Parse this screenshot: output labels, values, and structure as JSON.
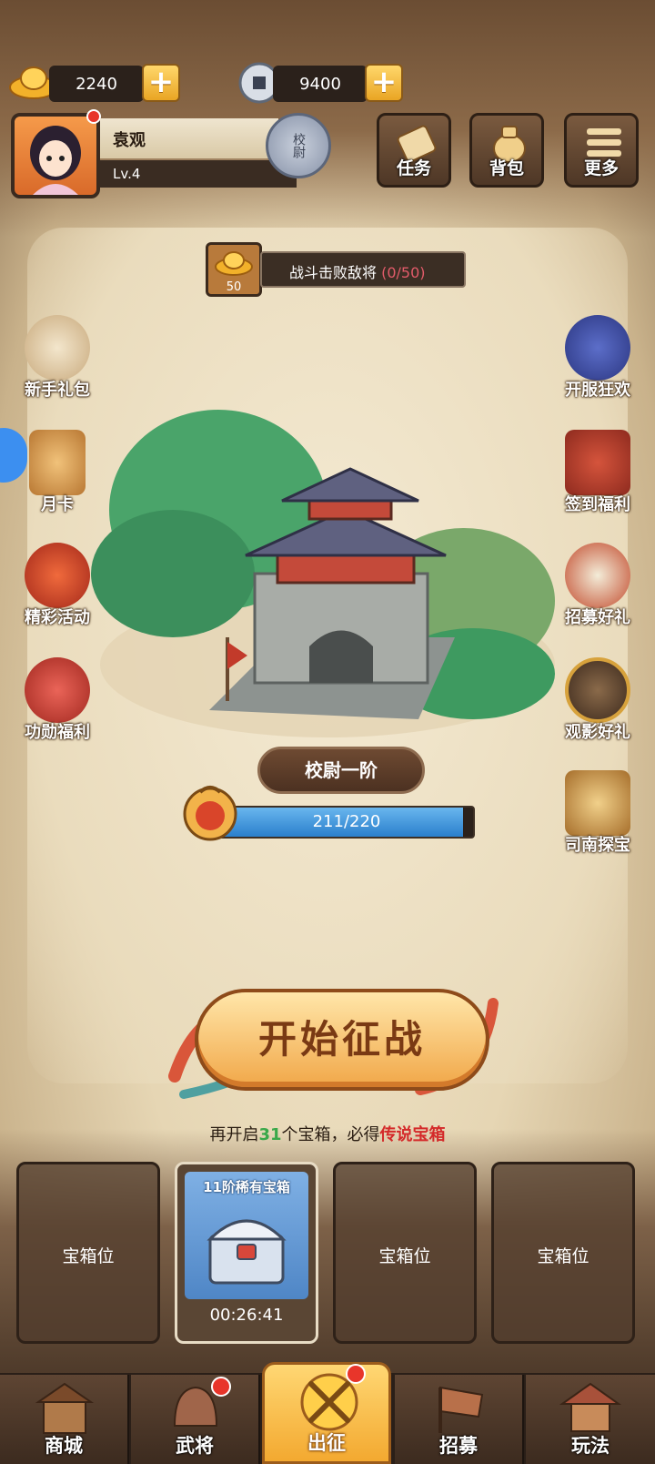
{
  "currency": {
    "gold": "2240",
    "coin": "9400",
    "gold_icon": "gold-ingot-icon",
    "coin_icon": "copper-coin-icon"
  },
  "player": {
    "name": "袁观",
    "level": "Lv.4",
    "rank_badge": "校尉"
  },
  "top_buttons": [
    {
      "label": "任务",
      "icon": "scroll-icon"
    },
    {
      "label": "背包",
      "icon": "bag-icon"
    },
    {
      "label": "更多",
      "icon": "menu-icon"
    }
  ],
  "quest": {
    "reward": "50",
    "text": "战斗击败敌将",
    "progress": "(0/50)"
  },
  "left_side": [
    {
      "label": "新手礼包",
      "icon": "hero-gift-icon"
    },
    {
      "label": "月卡",
      "icon": "month-card-icon"
    },
    {
      "label": "精彩活动",
      "icon": "event-bag-icon"
    },
    {
      "label": "功勋福利",
      "icon": "merit-pouch-icon"
    }
  ],
  "right_side": [
    {
      "label": "开服狂欢",
      "icon": "carnival-icon"
    },
    {
      "label": "签到福利",
      "icon": "signin-icon"
    },
    {
      "label": "招募好礼",
      "icon": "recruit-drum-icon"
    },
    {
      "label": "观影好礼",
      "icon": "video-gift-icon"
    },
    {
      "label": "司南探宝",
      "icon": "compass-icon"
    }
  ],
  "rank": {
    "title": "校尉一阶",
    "progress_text": "211/220",
    "progress_value": 0.959
  },
  "start_button": "开始征战",
  "chest_hint": {
    "pre": "再开启",
    "count": "31",
    "mid": "个宝箱，必得",
    "reward": "传说宝箱"
  },
  "chest_slots": [
    {
      "label": "宝箱位"
    },
    {
      "title": "11阶稀有宝箱",
      "timer": "00:26:41"
    },
    {
      "label": "宝箱位"
    },
    {
      "label": "宝箱位"
    }
  ],
  "nav": [
    {
      "label": "商城",
      "icon": "shop-icon"
    },
    {
      "label": "武将",
      "icon": "general-helmet-icon"
    },
    {
      "label": "出征",
      "icon": "campaign-icon"
    },
    {
      "label": "招募",
      "icon": "recruit-flag-icon"
    },
    {
      "label": "玩法",
      "icon": "pavilion-icon"
    }
  ],
  "colors": {
    "accent_gold": "#f3a930",
    "progress_blue": "#2a7fcc",
    "legend_red": "#d42a2a",
    "count_green": "#3aa84a"
  }
}
